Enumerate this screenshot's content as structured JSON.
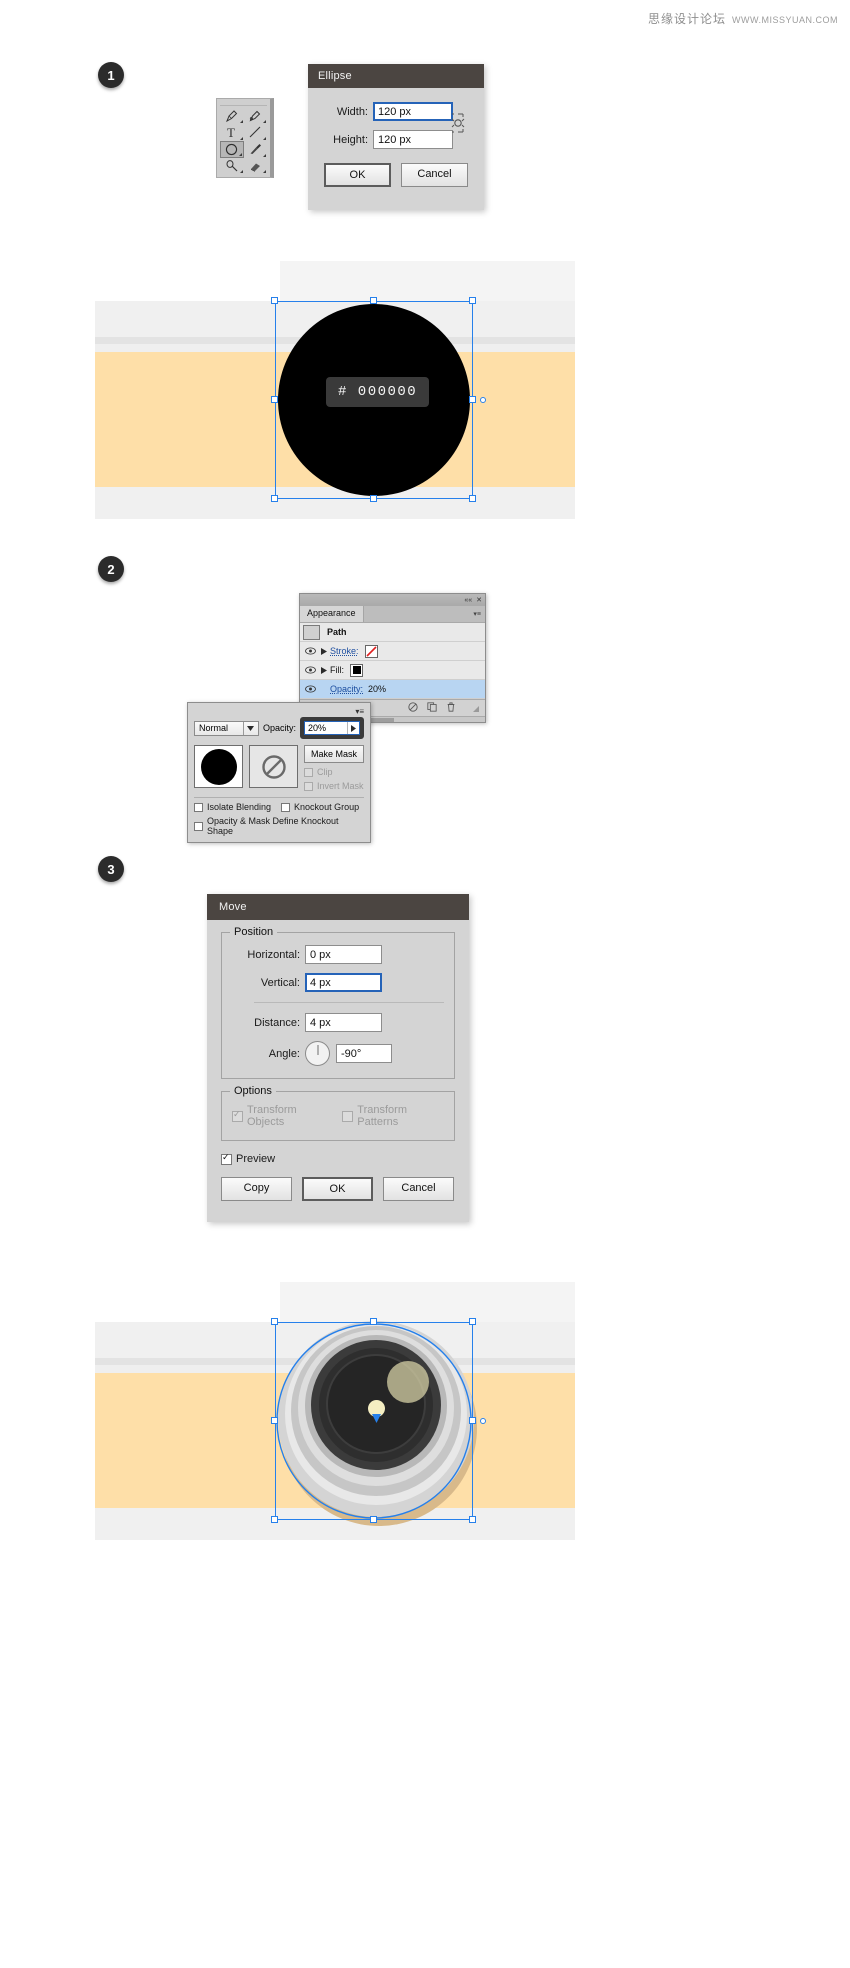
{
  "watermark": {
    "cn": "思缘设计论坛",
    "url": "WWW.MISSYUAN.COM"
  },
  "steps": [
    {
      "number": "1"
    },
    {
      "number": "2"
    },
    {
      "number": "3"
    }
  ],
  "tool_palette": {
    "tools": [
      {
        "name": "pen-tool",
        "has_flyout": true
      },
      {
        "name": "add-anchor-point-tool",
        "has_flyout": true
      },
      {
        "name": "type-tool",
        "has_flyout": true
      },
      {
        "name": "line-segment-tool",
        "has_flyout": true
      },
      {
        "name": "ellipse-tool",
        "has_flyout": true,
        "active": true
      },
      {
        "name": "paintbrush-tool",
        "has_flyout": true
      },
      {
        "name": "pencil-tool",
        "has_flyout": true
      },
      {
        "name": "eraser-tool",
        "has_flyout": true
      }
    ]
  },
  "ellipse_dialog": {
    "title": "Ellipse",
    "fields": [
      {
        "label": "Width:",
        "value": "120 px",
        "focused": true
      },
      {
        "label": "Height:",
        "value": "120 px",
        "focused": false
      }
    ],
    "constrain_icon": "constrain-proportions-icon",
    "buttons": [
      {
        "label": "OK",
        "default": true
      },
      {
        "label": "Cancel",
        "default": false
      }
    ]
  },
  "canvas_top": {
    "hex_label": "# 000000",
    "shape_color": "#000000",
    "band_color": "#fedfa8",
    "body_color": "#f0f0f0",
    "accent_color": "#e3e3e3",
    "selection_color": "#2680eb"
  },
  "appearance_panel": {
    "tab": "Appearance",
    "rows": [
      {
        "type": "header",
        "name": "Path"
      },
      {
        "type": "item",
        "name": "Stroke:",
        "swatch": "none",
        "link": true
      },
      {
        "type": "item",
        "name": "Fill:",
        "swatch": "#000000",
        "link": false
      },
      {
        "type": "item",
        "name": "Opacity:",
        "value": "20%",
        "link": true,
        "selected": true
      }
    ],
    "footer_icons": [
      "no-effect-icon",
      "duplicate-icon",
      "delete-icon"
    ]
  },
  "transparency_panel": {
    "blend_mode": "Normal",
    "opacity_label": "Opacity:",
    "opacity_value": "20%",
    "make_mask_label": "Make Mask",
    "clip_label": "Clip",
    "invert_mask_label": "Invert Mask",
    "isolate_blending_label": "Isolate Blending",
    "knockout_group_label": "Knockout Group",
    "opacity_mask_label": "Opacity & Mask Define Knockout Shape",
    "checkboxes": {
      "clip": {
        "checked": false,
        "disabled": true
      },
      "invert_mask": {
        "checked": false,
        "disabled": true
      },
      "isolate_blending": {
        "checked": false,
        "disabled": false
      },
      "knockout_group": {
        "checked": false,
        "disabled": false
      },
      "opacity_mask": {
        "checked": false,
        "disabled": false
      }
    }
  },
  "move_dialog": {
    "title": "Move",
    "position_legend": "Position",
    "options_legend": "Options",
    "fields": [
      {
        "label": "Horizontal:",
        "value": "0 px",
        "focused": false
      },
      {
        "label": "Vertical:",
        "value": "4 px",
        "focused": true
      },
      {
        "label": "Distance:",
        "value": "4 px",
        "focused": false
      },
      {
        "label": "Angle:",
        "value": "-90°",
        "focused": false
      }
    ],
    "options": [
      {
        "label": "Transform Objects",
        "checked": true,
        "disabled": true
      },
      {
        "label": "Transform Patterns",
        "checked": false,
        "disabled": true
      }
    ],
    "preview": {
      "label": "Preview",
      "checked": true
    },
    "buttons": [
      {
        "label": "Copy",
        "default": false
      },
      {
        "label": "OK",
        "default": true
      },
      {
        "label": "Cancel",
        "default": false
      }
    ]
  },
  "canvas_bottom": {
    "band_color": "#fedfa8",
    "body_color": "#f0f0f0",
    "lens_outer": "#cfcfcf",
    "lens_ring": "#b5b5b5",
    "lens_glass": "#333333",
    "lens_inner": "#2b2b2b",
    "highlight_color": "#c8c39a",
    "dot_color": "#f5eec2",
    "selection_color": "#2680eb"
  }
}
